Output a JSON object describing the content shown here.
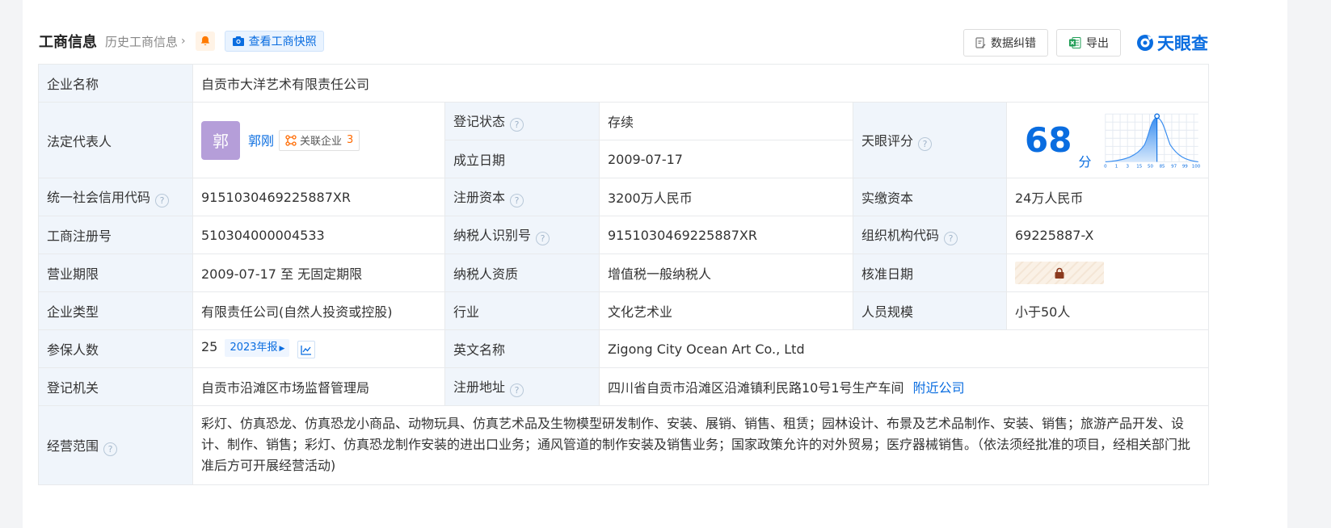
{
  "header": {
    "title": "工商信息",
    "history": "历史工商信息",
    "snapshot": "查看工商快照",
    "correction": "数据纠错",
    "export": "导出",
    "logo": "天眼查"
  },
  "company": {
    "name_label": "企业名称",
    "name": "自贡市大洋艺术有限责任公司",
    "legal_label": "法定代表人",
    "avatar_char": "郭",
    "legal_name": "郭刚",
    "related_label": "关联企业",
    "related_count": "3",
    "status_label": "登记状态",
    "status": "存续",
    "found_label": "成立日期",
    "found_date": "2009-07-17",
    "score_label": "天眼评分",
    "score": "68",
    "score_unit": "分",
    "score_axis": [
      "0",
      "1",
      "3",
      "15",
      "50",
      "85",
      "97",
      "99",
      "100"
    ],
    "credit_label": "统一社会信用代码",
    "credit_code": "9151030469225887XR",
    "reg_cap_label": "注册资本",
    "reg_cap": "3200万人民币",
    "paid_cap_label": "实缴资本",
    "paid_cap": "24万人民币",
    "biz_reg_label": "工商注册号",
    "biz_reg": "510304000004533",
    "taxpayer_id_label": "纳税人识别号",
    "taxpayer_id": "9151030469225887XR",
    "org_code_label": "组织机构代码",
    "org_code": "69225887-X",
    "term_label": "营业期限",
    "term": "2009-07-17 至 无固定期限",
    "tax_qual_label": "纳税人资质",
    "tax_qual": "增值税一般纳税人",
    "approve_label": "核准日期",
    "type_label": "企业类型",
    "type": "有限责任公司(自然人投资或控股)",
    "industry_label": "行业",
    "industry": "文化艺术业",
    "staff_label": "人员规模",
    "staff": "小于50人",
    "insured_label": "参保人数",
    "insured": "25",
    "insured_year": "2023年报",
    "en_name_label": "英文名称",
    "en_name": "Zigong City Ocean Art Co., Ltd",
    "authority_label": "登记机关",
    "authority": "自贡市沿滩区市场监督管理局",
    "address_label": "注册地址",
    "address": "四川省自贡市沿滩区沿滩镇利民路10号1号生产车间",
    "nearby": "附近公司",
    "scope_label": "经营范围",
    "scope": "彩灯、仿真恐龙、仿真恐龙小商品、动物玩具、仿真艺术品及生物模型研发制作、安装、展销、销售、租赁；园林设计、布景及艺术品制作、安装、销售；旅游产品开发、设计、制作、销售；彩灯、仿真恐龙制作安装的进出口业务；通风管道的制作安装及销售业务；国家政策允许的对外贸易；医疗器械销售。（依法须经批准的项目，经相关部门批准后方可开展经营活动)"
  },
  "colors": {
    "brand_blue": "#0a6de0",
    "status_green": "#129c3e",
    "label_bg": "#f0f5fb",
    "avatar_purple": "#b59ed9"
  }
}
